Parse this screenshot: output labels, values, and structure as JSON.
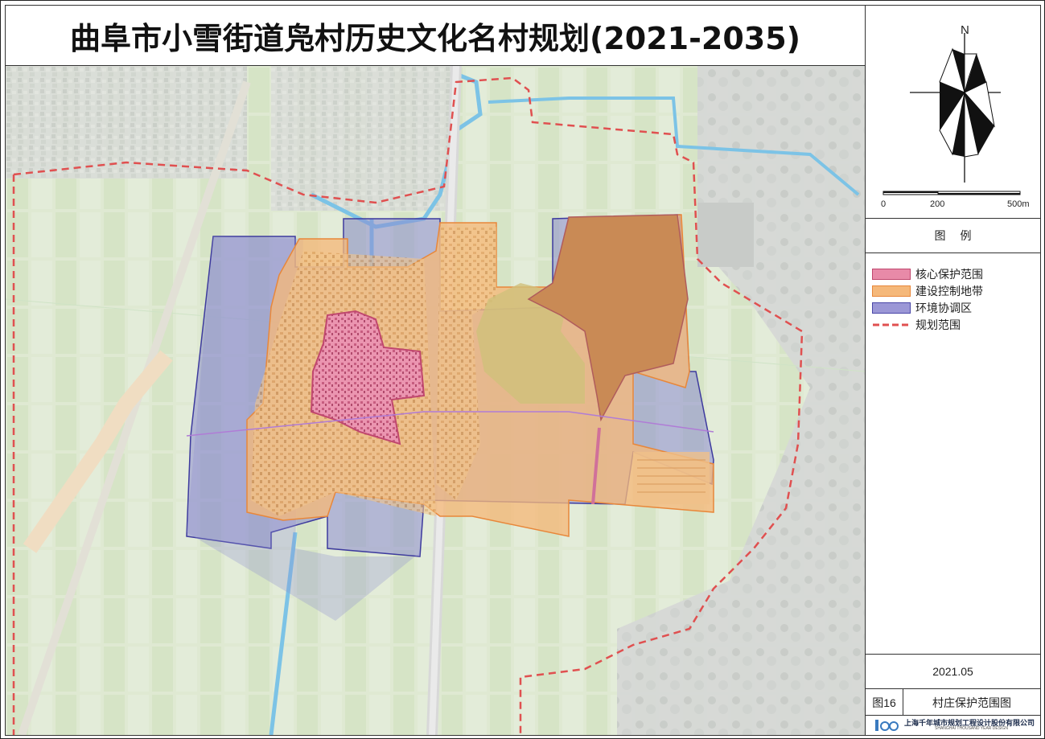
{
  "title": "曲阜市小雪街道凫村历史文化名村规划(2021-2035)",
  "compass": {
    "north_label": "N"
  },
  "scale_bar": {
    "labels": [
      "0",
      "200",
      "500m"
    ]
  },
  "legend": {
    "title": "图例",
    "items": [
      {
        "label": "核心保护范围",
        "color": "#e88aa8",
        "border": "#c0476e"
      },
      {
        "label": "建设控制地带",
        "color": "#f5b87a",
        "border": "#e8873a"
      },
      {
        "label": "环境协调区",
        "color": "#9b97d6",
        "border": "#4a47a8"
      },
      {
        "label": "规划范围",
        "color": "#e05050",
        "border": "#e05050"
      }
    ]
  },
  "date": "2021.05",
  "figure": {
    "number": "图16",
    "name": "村庄保护范围图"
  },
  "footer": {
    "company": "上海千年城市规划工程设计股份有限公司",
    "company_en": "SHANGHAI THOUSAND YEAR DESIGN"
  }
}
